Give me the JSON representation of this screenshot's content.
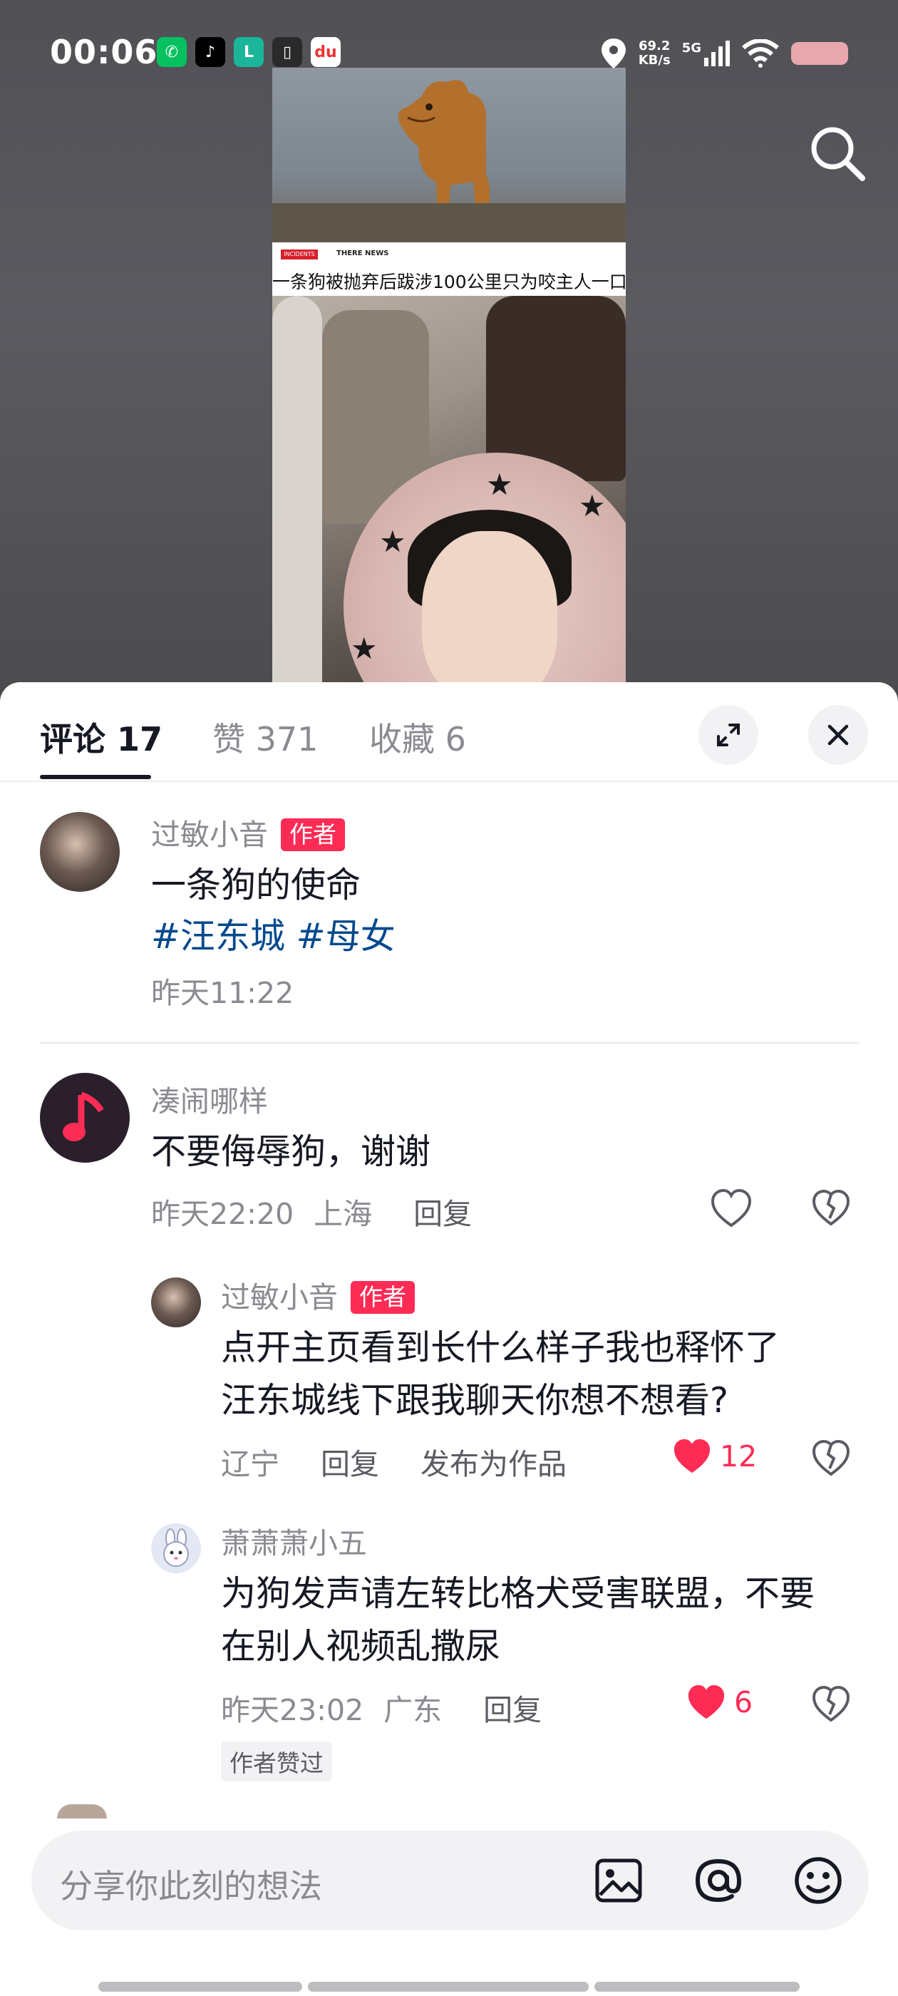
{
  "status_bar": {
    "time": "00:06",
    "net_speed": "69.2",
    "net_unit": "KB/s",
    "signal": "5G"
  },
  "video": {
    "news_badge": "INCIDENTS",
    "news_brand": "THERE NEWS",
    "caption": "一条狗被抛弃后跋涉100公里只为咬主人一口"
  },
  "tabs": [
    {
      "label": "评论 17"
    },
    {
      "label": "赞 371"
    },
    {
      "label": "收藏 6"
    }
  ],
  "author_post": {
    "username": "过敏小音",
    "tag": "作者",
    "text": "一条狗的使命",
    "hashtags": "#汪东城 #母女",
    "time": "昨天11:22"
  },
  "comments": [
    {
      "username": "凑闹哪样",
      "text": "不要侮辱狗，谢谢",
      "time": "昨天22:20",
      "location": "上海",
      "reply": "回复"
    }
  ],
  "replies": [
    {
      "username": "过敏小音",
      "tag": "作者",
      "line1": "点开主页看到长什么样子我也释怀了",
      "line2": "汪东城线下跟我聊天你想不想看?",
      "location": "辽宁",
      "reply": "回复",
      "publish": "发布为作品",
      "likes": "12"
    },
    {
      "username": "萧萧萧小五",
      "line1": "为狗发声请左转比格犬受害联盟，不要",
      "line2": "在别人视频乱撒尿",
      "time": "昨天23:02",
      "location": "广东",
      "reply": "回复",
      "likes": "6",
      "liked_by_author": "作者赞过"
    }
  ],
  "input": {
    "placeholder": "分享你此刻的想法"
  },
  "colors": {
    "accent": "#fe2c55",
    "hashtag": "#04498d",
    "muted": "#8a8b91"
  }
}
